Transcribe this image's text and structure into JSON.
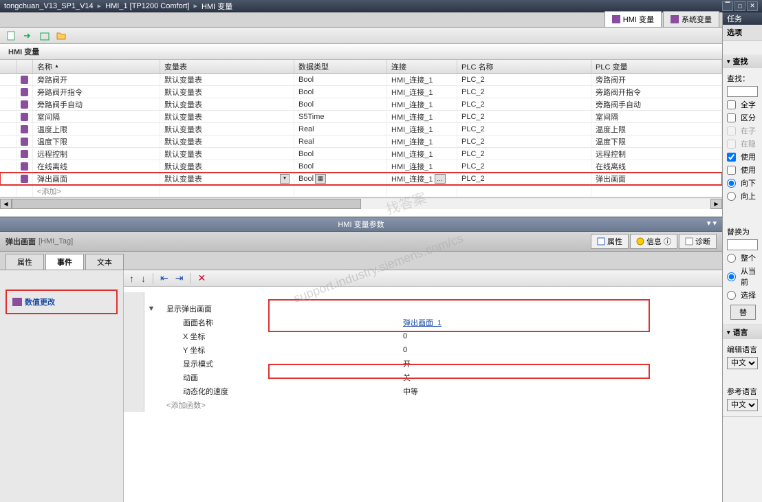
{
  "title": {
    "project": "tongchuan_V13_SP1_V14",
    "device": "HMI_1 [TP1200 Comfort]",
    "section": "HMI 变量"
  },
  "task_panel": {
    "title": "任务",
    "options": "选项",
    "find_section": "查找",
    "find_label": "查找：",
    "whole_word": "全字",
    "case_sensitive": "区分",
    "in_sub": "在子",
    "in_hidden": "在隐",
    "use_1": "使用",
    "use_2": "使用",
    "down": "向下",
    "up": "向上",
    "replace_label": "替换为",
    "whole_doc": "整个",
    "from_current": "从当前",
    "selection": "选择",
    "replace_btn": "替",
    "lang_section": "语言",
    "edit_lang_label": "编辑语言",
    "edit_lang_value": "中文（",
    "ref_lang_label": "参考语言",
    "ref_lang_value": "中文（"
  },
  "main_tabs": {
    "hmi_vars": "HMI 变量",
    "system_vars": "系统变量"
  },
  "grid": {
    "title": "HMI 变量",
    "headers": {
      "name": "名称",
      "table": "变量表",
      "datatype": "数据类型",
      "connection": "连接",
      "plc_name": "PLC 名称",
      "plc_var": "PLC 变量"
    },
    "rows": [
      {
        "name": "旁路阀开",
        "table": "默认变量表",
        "type": "Bool",
        "conn": "HMI_连接_1",
        "plc": "PLC_2",
        "plcvar": "旁路阀开"
      },
      {
        "name": "旁路阀开指令",
        "table": "默认变量表",
        "type": "Bool",
        "conn": "HMI_连接_1",
        "plc": "PLC_2",
        "plcvar": "旁路阀开指令"
      },
      {
        "name": "旁路阀手自动",
        "table": "默认变量表",
        "type": "Bool",
        "conn": "HMI_连接_1",
        "plc": "PLC_2",
        "plcvar": "旁路阀手自动"
      },
      {
        "name": "室间隔",
        "table": "默认变量表",
        "type": "S5Time",
        "conn": "HMI_连接_1",
        "plc": "PLC_2",
        "plcvar": "室间隔"
      },
      {
        "name": "温度上限",
        "table": "默认变量表",
        "type": "Real",
        "conn": "HMI_连接_1",
        "plc": "PLC_2",
        "plcvar": "温度上限"
      },
      {
        "name": "温度下限",
        "table": "默认变量表",
        "type": "Real",
        "conn": "HMI_连接_1",
        "plc": "PLC_2",
        "plcvar": "温度下限"
      },
      {
        "name": "远程控制",
        "table": "默认变量表",
        "type": "Bool",
        "conn": "HMI_连接_1",
        "plc": "PLC_2",
        "plcvar": "远程控制"
      },
      {
        "name": "在线离线",
        "table": "默认变量表",
        "type": "Bool",
        "conn": "HMI_连接_1",
        "plc": "PLC_2",
        "plcvar": "在线离线"
      },
      {
        "name": "弹出画面",
        "table": "默认变量表",
        "type": "Bool",
        "conn": "HMI_连接_1",
        "plc": "PLC_2",
        "plcvar": "弹出画面"
      }
    ],
    "add_row": "<添加>"
  },
  "splitter": {
    "label": "HMI 变量参数"
  },
  "detail": {
    "title": "弹出画面",
    "subtitle": "[HMI_Tag]",
    "buttons": {
      "properties": "属性",
      "info": "信息",
      "diagnostics": "诊断"
    },
    "tabs": {
      "prop": "属性",
      "event": "事件",
      "text": "文本"
    },
    "event_item": "数值更改",
    "func": {
      "root": "显示弹出画面",
      "screen_name_label": "画面名称",
      "screen_name_value": "弹出画面_1",
      "x_label": "X 坐标",
      "x_value": "0",
      "y_label": "Y 坐标",
      "y_value": "0",
      "mode_label": "显示模式",
      "mode_value": "开",
      "anim_label": "动画",
      "anim_value": "关",
      "speed_label": "动态化的速度",
      "speed_value": "中等",
      "add_func": "<添加函数>"
    }
  }
}
